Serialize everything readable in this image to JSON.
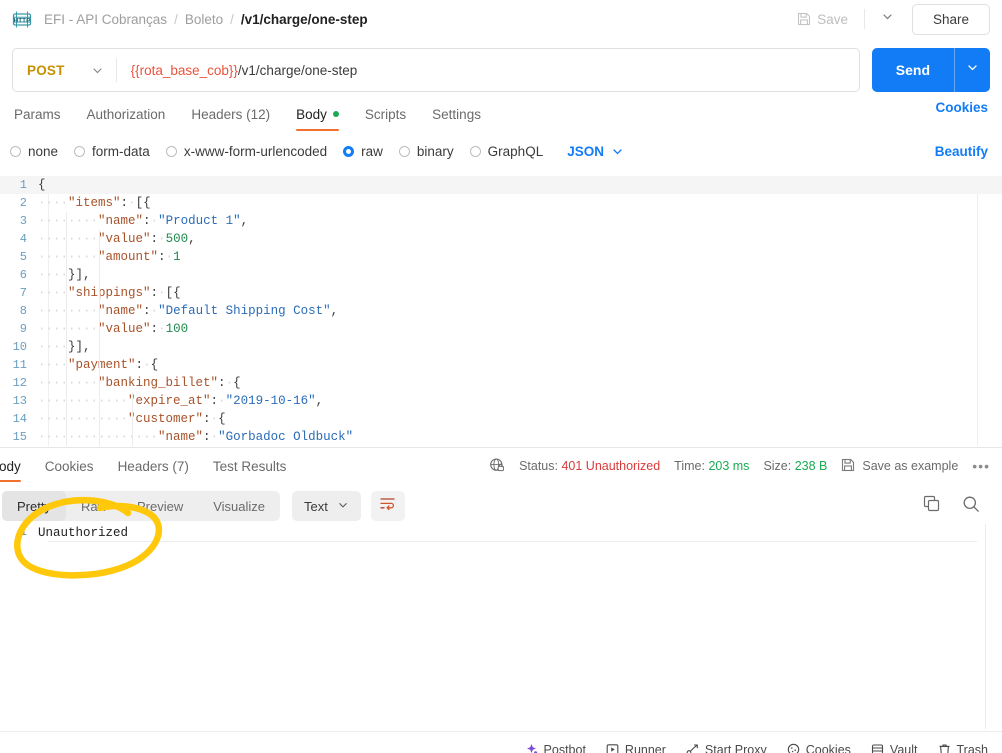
{
  "topbar": {
    "logo_icon": "http-badge-icon",
    "breadcrumb": {
      "collection": "EFI - API Cobranças",
      "folder": "Boleto",
      "request": "/v1/charge/one-step",
      "separator": "/"
    },
    "save_label": "Save",
    "save_icon": "floppy-disk-icon",
    "save_dropdown_icon": "chevron-down-icon",
    "share_label": "Share"
  },
  "url_row": {
    "method": "POST",
    "method_chevron_icon": "chevron-down-icon",
    "url_variable": "{{rota_base_cob}}",
    "url_path": "/v1/charge/one-step",
    "send_label": "Send",
    "send_chevron_icon": "chevron-down-icon"
  },
  "request_tabs": {
    "items": [
      {
        "label": "Params",
        "active": false,
        "dot": false
      },
      {
        "label": "Authorization",
        "active": false,
        "dot": false
      },
      {
        "label": "Headers (12)",
        "active": false,
        "dot": false
      },
      {
        "label": "Body",
        "active": true,
        "dot": true
      },
      {
        "label": "Scripts",
        "active": false,
        "dot": false
      },
      {
        "label": "Settings",
        "active": false,
        "dot": false
      }
    ],
    "cookies_label": "Cookies"
  },
  "body_type_row": {
    "options": [
      {
        "label": "none",
        "selected": false
      },
      {
        "label": "form-data",
        "selected": false
      },
      {
        "label": "x-www-form-urlencoded",
        "selected": false
      },
      {
        "label": "raw",
        "selected": true
      },
      {
        "label": "binary",
        "selected": false
      },
      {
        "label": "GraphQL",
        "selected": false
      }
    ],
    "format_label": "JSON",
    "format_chevron_icon": "chevron-down-icon",
    "beautify_label": "Beautify"
  },
  "editor": {
    "lines": [
      {
        "num": "1",
        "text": "{"
      },
      {
        "num": "2",
        "text": "    \"items\": [{"
      },
      {
        "num": "3",
        "text": "        \"name\": \"Product 1\","
      },
      {
        "num": "4",
        "text": "        \"value\": 500,"
      },
      {
        "num": "5",
        "text": "        \"amount\": 1"
      },
      {
        "num": "6",
        "text": "    }],"
      },
      {
        "num": "7",
        "text": "    \"shippings\": [{"
      },
      {
        "num": "8",
        "text": "        \"name\": \"Default Shipping Cost\","
      },
      {
        "num": "9",
        "text": "        \"value\": 100"
      },
      {
        "num": "10",
        "text": "    }],"
      },
      {
        "num": "11",
        "text": "    \"payment\": {"
      },
      {
        "num": "12",
        "text": "        \"banking_billet\": {"
      },
      {
        "num": "13",
        "text": "            \"expire_at\": \"2019-10-16\","
      },
      {
        "num": "14",
        "text": "            \"customer\": {"
      },
      {
        "num": "15",
        "text": "                \"name\": \"Gorbadoc Oldbuck\""
      }
    ]
  },
  "response_bar": {
    "tabs": [
      {
        "label": "Body",
        "active": true
      },
      {
        "label": "Cookies",
        "active": false
      },
      {
        "label": "Headers (7)",
        "active": false
      },
      {
        "label": "Test Results",
        "active": false
      }
    ],
    "globe_icon": "globe-lock-icon",
    "status_label": "Status:",
    "status_value": "401 Unauthorized",
    "time_label": "Time:",
    "time_value": "203 ms",
    "size_label": "Size:",
    "size_value": "238 B",
    "save_example_icon": "floppy-disk-icon",
    "save_example_label": "Save as example",
    "more_icon": "ellipsis-icon"
  },
  "response_tools": {
    "views": [
      {
        "label": "Pretty",
        "active": true
      },
      {
        "label": "Raw",
        "active": false
      },
      {
        "label": "Preview",
        "active": false
      },
      {
        "label": "Visualize",
        "active": false
      }
    ],
    "format_label": "Text",
    "format_chevron_icon": "chevron-down-icon",
    "wrap_icon": "word-wrap-icon",
    "copy_icon": "copy-icon",
    "search_icon": "search-icon"
  },
  "response_body": {
    "lines": [
      {
        "num": "1",
        "text": "Unauthorized"
      }
    ]
  },
  "annotation": {
    "shape": "hand-drawn-ellipse",
    "color": "#FFC80A",
    "target": "Unauthorized"
  },
  "bottom_bar": {
    "items": [
      {
        "label": "Postbot",
        "icon": "postbot-icon"
      },
      {
        "label": "Runner",
        "icon": "runner-icon"
      },
      {
        "label": "Start Proxy",
        "icon": "proxy-icon"
      },
      {
        "label": "Cookies",
        "icon": "cookie-icon"
      },
      {
        "label": "Vault",
        "icon": "vault-icon"
      },
      {
        "label": "Trash",
        "icon": "trash-icon"
      }
    ]
  },
  "colors": {
    "accent_blue": "#127CF7",
    "accent_orange": "#F0722E",
    "method_post": "#C79000",
    "status_error": "#D93B3B",
    "status_ok": "#1AAB52",
    "annotation_yellow": "#FFC80A"
  }
}
